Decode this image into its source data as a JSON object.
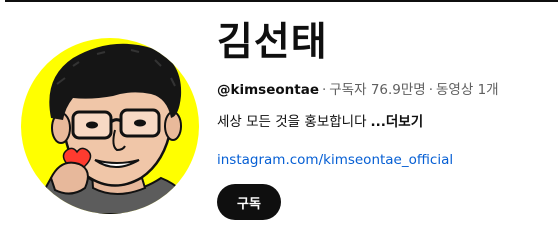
{
  "channel": {
    "name": "김선태",
    "handle": "@kimseontae",
    "subscribers": "구독자 76.9만명",
    "videos": "동영상 1개",
    "separator": "·",
    "description": "세상 모든 것을 홍보합니다",
    "ellipsis": "...",
    "more_label": "더보기",
    "link": "instagram.com/kimseontae_official",
    "subscribe_label": "구독",
    "avatar_bg": "#ffff00"
  }
}
